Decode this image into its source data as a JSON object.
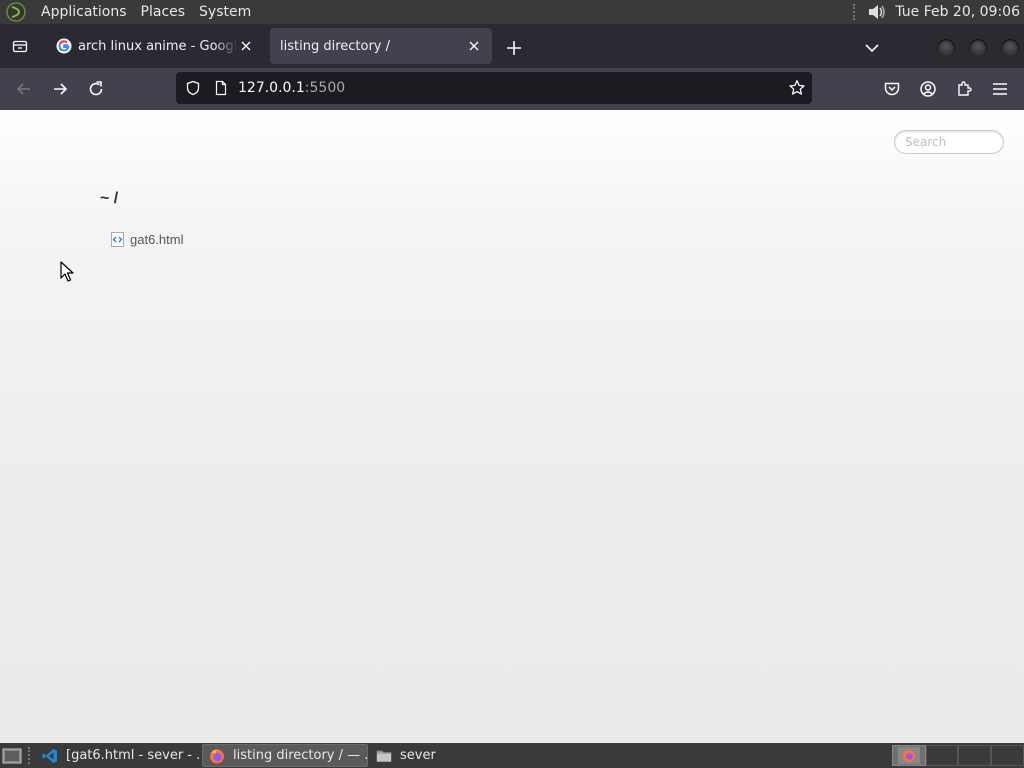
{
  "top_panel": {
    "menus": [
      "Applications",
      "Places",
      "System"
    ],
    "clock": "Tue Feb 20, 09:06"
  },
  "browser": {
    "tabs": [
      {
        "title": "arch linux anime - Google Search",
        "favicon": "google-icon",
        "active": false
      },
      {
        "title": "listing directory /",
        "favicon": "none",
        "active": true
      }
    ],
    "url": {
      "host": "127.0.0.1",
      "port": ":5500"
    }
  },
  "page": {
    "search_placeholder": "Search",
    "breadcrumb": "~ /",
    "files": [
      {
        "name": "gat6.html",
        "icon": "html-file-icon"
      }
    ]
  },
  "taskbar": {
    "tasks": [
      {
        "label": "[gat6.html - sever - ...",
        "icon": "vscode-icon",
        "active": false
      },
      {
        "label": "listing directory / — ...",
        "icon": "firefox-icon",
        "active": true
      },
      {
        "label": "sever",
        "icon": "folder-icon",
        "active": false
      }
    ]
  },
  "colors": {
    "panel": "#3a3a3a",
    "tabbar": "#2b2a33",
    "toolbar": "#42414d",
    "urlbar": "#1c1b22"
  }
}
